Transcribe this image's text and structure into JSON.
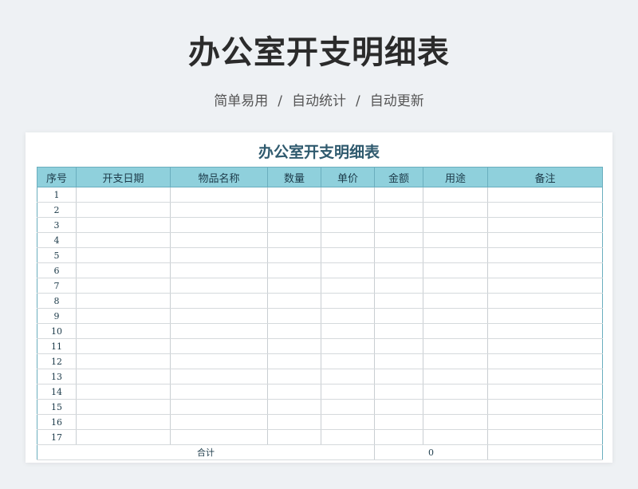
{
  "header": {
    "title": "办公室开支明细表",
    "features": [
      "简单易用",
      "自动统计",
      "自动更新"
    ],
    "separator": "/"
  },
  "sheet": {
    "title": "办公室开支明细表",
    "columns": [
      "序号",
      "开支日期",
      "物品名称",
      "数量",
      "单价",
      "金额",
      "用途",
      "备注"
    ],
    "row_numbers": [
      "1",
      "2",
      "3",
      "4",
      "5",
      "6",
      "7",
      "8",
      "9",
      "10",
      "11",
      "12",
      "13",
      "14",
      "15",
      "16",
      "17"
    ],
    "total_label": "合计",
    "total_amount": "0"
  },
  "colors": {
    "header_fill": "#8fd0dc",
    "title_text": "#2f5a6e",
    "page_bg": "#eef1f4"
  }
}
